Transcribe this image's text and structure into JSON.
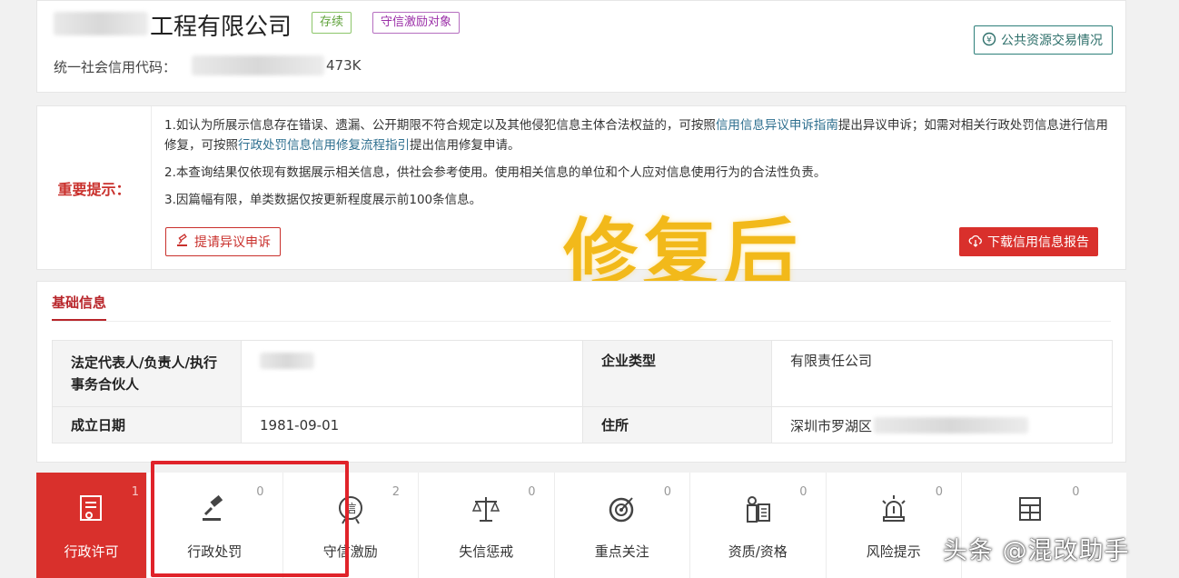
{
  "company": {
    "name_suffix": "工程有限公司",
    "tags": [
      "存续",
      "守信激励对象"
    ],
    "credit_code_label": "统一社会信用代码：",
    "credit_code_suffix": "473K",
    "trade_button": "公共资源交易情况"
  },
  "notice": {
    "label": "重要提示：",
    "line1_a": "1.如认为所展示信息存在错误、遗漏、公开期限不符合规定以及其他侵犯信息主体合法权益的，可按照",
    "line1_link1": "信用信息异议申诉指南",
    "line1_b": "提出异议申诉；如需对相关行政处罚信息进行信用修复，可按照",
    "line1_link2": "行政处罚信息信用修复流程指引",
    "line1_c": "提出信用修复申请。",
    "line2": "2.本查询结果仅依现有数据展示相关信息，供社会参考使用。使用相关信息的单位和个人应对信息使用行为的合法性负责。",
    "line3": "3.因篇幅有限，单类数据仅按更新程度展示前100条信息。",
    "appeal_button": "提请异议申诉",
    "download_button": "下载信用信息报告",
    "watermark": "修复后"
  },
  "basic": {
    "title": "基础信息",
    "legal_rep_label": "法定代表人/负责人/执行事务合伙人",
    "company_type_label": "企业类型",
    "company_type_value": "有限责任公司",
    "founded_label": "成立日期",
    "founded_value": "1981-09-01",
    "address_label": "住所",
    "address_value": "深圳市罗湖区"
  },
  "tabs": [
    {
      "label": "行政许可",
      "count": "1",
      "icon": "license-icon"
    },
    {
      "label": "行政处罚",
      "count": "0",
      "icon": "gavel-icon"
    },
    {
      "label": "守信激励",
      "count": "2",
      "icon": "trust-seal-icon"
    },
    {
      "label": "失信惩戒",
      "count": "0",
      "icon": "scales-icon"
    },
    {
      "label": "重点关注",
      "count": "0",
      "icon": "target-icon"
    },
    {
      "label": "资质/资格",
      "count": "0",
      "icon": "certificate-icon"
    },
    {
      "label": "风险提示",
      "count": "0",
      "icon": "alarm-icon"
    },
    {
      "label": "",
      "count": "0",
      "icon": "document-grid-icon"
    }
  ],
  "footer_credit": "头条 @混改助手",
  "colors": {
    "accent_red": "#d9302c",
    "watermark_gold": "#f2b91a",
    "link_teal": "#2e6f8f"
  }
}
